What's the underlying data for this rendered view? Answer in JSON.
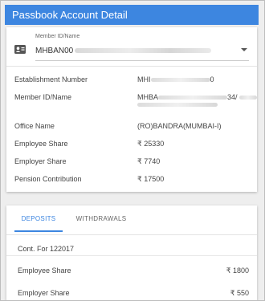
{
  "header": {
    "title": "Passbook Account Detail"
  },
  "member_select": {
    "caption": "Member ID/Name",
    "value_prefix": "MHBAN00"
  },
  "details": [
    {
      "label": "Establishment Number",
      "value_prefix": "MHI",
      "value_suffix": "0"
    },
    {
      "label": "Member ID/Name",
      "value_prefix": "MHBA",
      "value_suffix": "34/"
    },
    {
      "label": "Office Name",
      "value": "(RO)BANDRA(MUMBAI-I)"
    },
    {
      "label": "Employee Share",
      "value": "₹ 25330"
    },
    {
      "label": "Employer Share",
      "value": "₹ 7740"
    },
    {
      "label": "Pension Contribution",
      "value": "₹ 17500"
    }
  ],
  "tabs": [
    {
      "label": "DEPOSITS",
      "active": true
    },
    {
      "label": "WITHDRAWALS",
      "active": false
    }
  ],
  "deposits": {
    "title": "Cont. For 122017",
    "rows": [
      {
        "label": "Employee Share",
        "value": "₹ 1800"
      },
      {
        "label": "Employer Share",
        "value": "₹ 550"
      }
    ]
  },
  "colors": {
    "accent": "#3d86e0"
  }
}
